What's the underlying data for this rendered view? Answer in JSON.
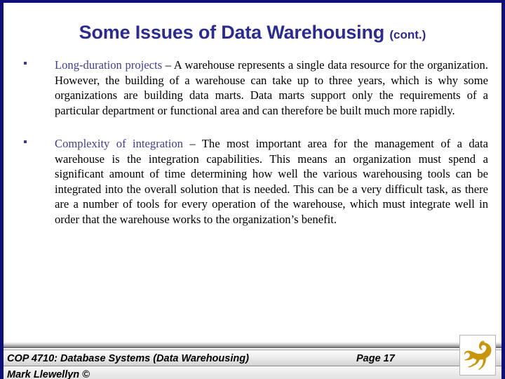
{
  "slide": {
    "title_main": "Some Issues of Data Warehousing",
    "title_suffix": "(cont.)",
    "title_color": "#2c2c8f",
    "border_color": "#0f0f7a",
    "bullets": [
      {
        "marker": "square-bullet",
        "term": "Long-duration projects",
        "text": " – A warehouse represents a single data resource for the organization.  However, the building of a warehouse can take up to three years, which is why some organizations are building data marts. Data marts support only the requirements of a particular department or functional area and can therefore be built much more rapidly."
      },
      {
        "marker": "square-bullet",
        "term": "Complexity of integration",
        "text": " – The most important area for the management of a data warehouse is the integration capabilities.  This means an organization must spend a significant amount of time determining how well the various warehousing tools can be integrated into the overall solution that is needed.  This can be a very difficult task, as there are a number of tools for every operation of the warehouse, which must integrate well in order that the warehouse works to the organization’s benefit."
      }
    ]
  },
  "footer": {
    "course": "COP 4710: Database Systems  (Data Warehousing)",
    "page": "Page 17",
    "author": "Mark Llewellyn ©",
    "logo_name": "ucf-pegasus-logo",
    "logo_color": "#c8960c"
  }
}
